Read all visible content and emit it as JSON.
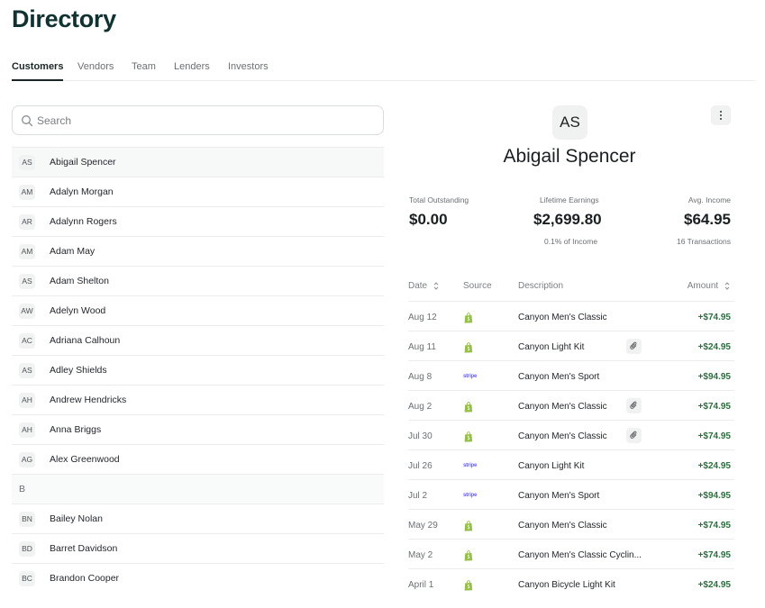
{
  "page": {
    "title": "Directory"
  },
  "tabs": [
    {
      "label": "Customers",
      "active": true
    },
    {
      "label": "Vendors",
      "active": false
    },
    {
      "label": "Team",
      "active": false
    },
    {
      "label": "Lenders",
      "active": false
    },
    {
      "label": "Investors",
      "active": false
    }
  ],
  "search": {
    "placeholder": "Search",
    "value": ""
  },
  "list": {
    "rows": [
      {
        "kind": "contact",
        "initials": "AS",
        "name": "Abigail Spencer",
        "selected": true
      },
      {
        "kind": "contact",
        "initials": "AM",
        "name": "Adalyn Morgan"
      },
      {
        "kind": "contact",
        "initials": "AR",
        "name": "Adalynn Rogers"
      },
      {
        "kind": "contact",
        "initials": "AM",
        "name": "Adam May"
      },
      {
        "kind": "contact",
        "initials": "AS",
        "name": "Adam Shelton"
      },
      {
        "kind": "contact",
        "initials": "AW",
        "name": "Adelyn Wood"
      },
      {
        "kind": "contact",
        "initials": "AC",
        "name": "Adriana Calhoun"
      },
      {
        "kind": "contact",
        "initials": "AS",
        "name": "Adley Shields"
      },
      {
        "kind": "contact",
        "initials": "AH",
        "name": "Andrew Hendricks"
      },
      {
        "kind": "contact",
        "initials": "AH",
        "name": "Anna Briggs"
      },
      {
        "kind": "contact",
        "initials": "AG",
        "name": "Alex Greenwood"
      },
      {
        "kind": "header",
        "letter": "B"
      },
      {
        "kind": "contact",
        "initials": "BN",
        "name": "Bailey Nolan"
      },
      {
        "kind": "contact",
        "initials": "BD",
        "name": "Barret Davidson"
      },
      {
        "kind": "contact",
        "initials": "BC",
        "name": "Brandon Cooper"
      }
    ]
  },
  "detail": {
    "initials": "AS",
    "name": "Abigail Spencer",
    "stats": {
      "outstanding": {
        "label": "Total Outstanding",
        "value": "$0.00"
      },
      "earnings": {
        "label": "Lifetime Earnings",
        "value": "$2,699.80",
        "sub": "0.1% of Income"
      },
      "income": {
        "label": "Avg. Income",
        "value": "$64.95",
        "sub": "16 Transactions"
      }
    },
    "columns": {
      "date": "Date",
      "source": "Source",
      "description": "Description",
      "amount": "Amount"
    },
    "transactions": [
      {
        "date": "Aug 12",
        "source": "shopify",
        "description": "Canyon Men's Classic",
        "attachment": false,
        "amount": "+$74.95"
      },
      {
        "date": "Aug 11",
        "source": "shopify",
        "description": "Canyon Light Kit",
        "attachment": true,
        "amount": "+$24.95"
      },
      {
        "date": "Aug 8",
        "source": "stripe",
        "description": "Canyon Men's Sport",
        "attachment": false,
        "amount": "+$94.95"
      },
      {
        "date": "Aug 2",
        "source": "shopify",
        "description": "Canyon Men's Classic",
        "attachment": true,
        "amount": "+$74.95"
      },
      {
        "date": "Jul 30",
        "source": "shopify",
        "description": "Canyon Men's Classic",
        "attachment": true,
        "amount": "+$74.95"
      },
      {
        "date": "Jul 26",
        "source": "stripe",
        "description": "Canyon Light Kit",
        "attachment": false,
        "amount": "+$24.95"
      },
      {
        "date": "Jul 2",
        "source": "stripe",
        "description": "Canyon Men's Sport",
        "attachment": false,
        "amount": "+$94.95"
      },
      {
        "date": "May 29",
        "source": "shopify",
        "description": "Canyon Men's Classic",
        "attachment": false,
        "amount": "+$74.95"
      },
      {
        "date": "May 2",
        "source": "shopify",
        "description": "Canyon Men's Classic Cyclin...",
        "attachment": false,
        "amount": "+$74.95"
      },
      {
        "date": "April 1",
        "source": "shopify",
        "description": "Canyon Bicycle Light Kit",
        "attachment": false,
        "amount": "+$24.95"
      }
    ]
  },
  "labels": {
    "stripe_logo": "stripe"
  },
  "colors": {
    "title": "#123232",
    "amount_positive": "#2c6e3f",
    "shopify_green": "#95bf47",
    "stripe_purple": "#635bff"
  }
}
